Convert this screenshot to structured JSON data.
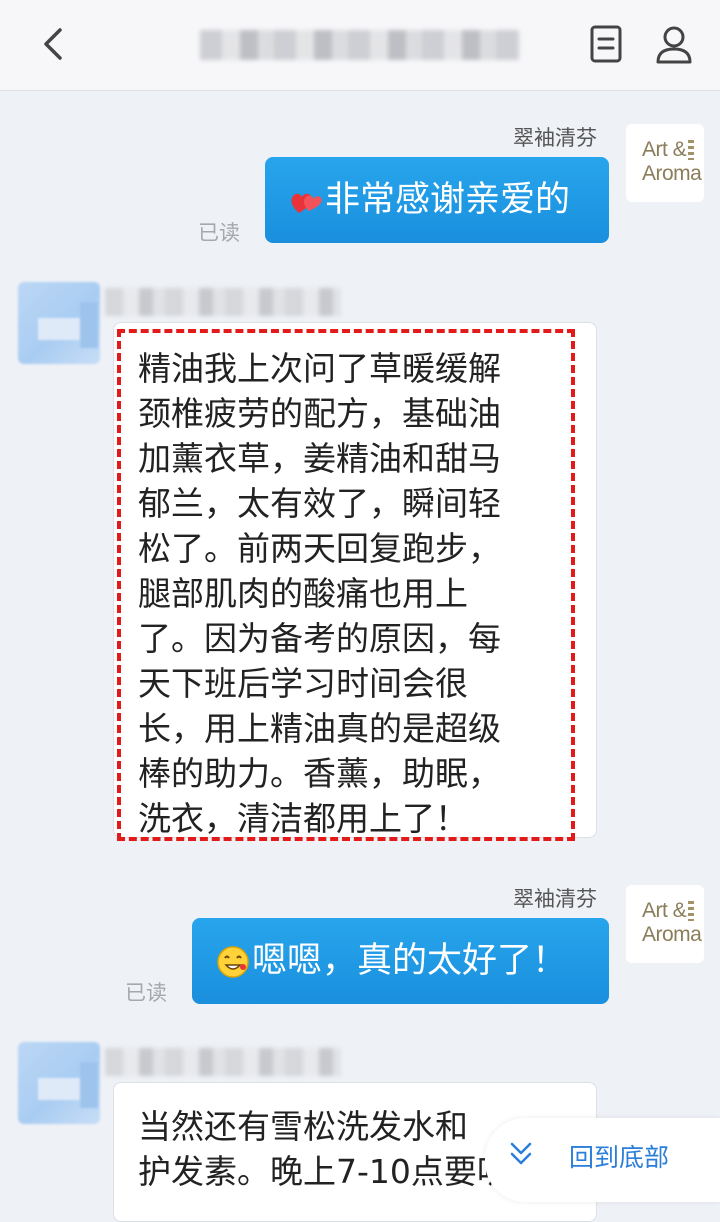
{
  "header": {
    "back_icon": "chevron-left-icon",
    "doc_icon": "document-icon",
    "user_icon": "user-icon"
  },
  "messages": [
    {
      "direction": "out",
      "sender": "翠袖清芬",
      "avatar_brand": [
        "Art &",
        "Aroma"
      ],
      "emoji": "hearts-emoji",
      "text": "非常感谢亲爱的",
      "status": "已读"
    },
    {
      "direction": "in",
      "text": "精油我上次问了草暖缓解\n颈椎疲劳的配方，基础油\n加薰衣草，姜精油和甜马\n郁兰，太有效了，瞬间轻\n松了。前两天回复跑步，\n腿部肌肉的酸痛也用上\n了。因为备考的原因，每\n天下班后学习时间会很\n长，用上精油真的是超级\n棒的助力。香薰，助眠，\n洗衣，清洁都用上了！",
      "highlighted": true
    },
    {
      "direction": "out",
      "sender": "翠袖清芬",
      "avatar_brand": [
        "Art &",
        "Aroma"
      ],
      "emoji": "happy-face-emoji",
      "text": "嗯嗯，真的太好了！",
      "status": "已读"
    },
    {
      "direction": "in",
      "text": "当然还有雪松洗发水和\n护发素。晚上7-10点要听"
    }
  ],
  "back_to_bottom": {
    "label": "回到底部",
    "icon": "double-chevron-down-icon"
  },
  "colors": {
    "accent": "#1a8fdd",
    "highlight": "#e31a1a",
    "link": "#2a7ed9"
  }
}
